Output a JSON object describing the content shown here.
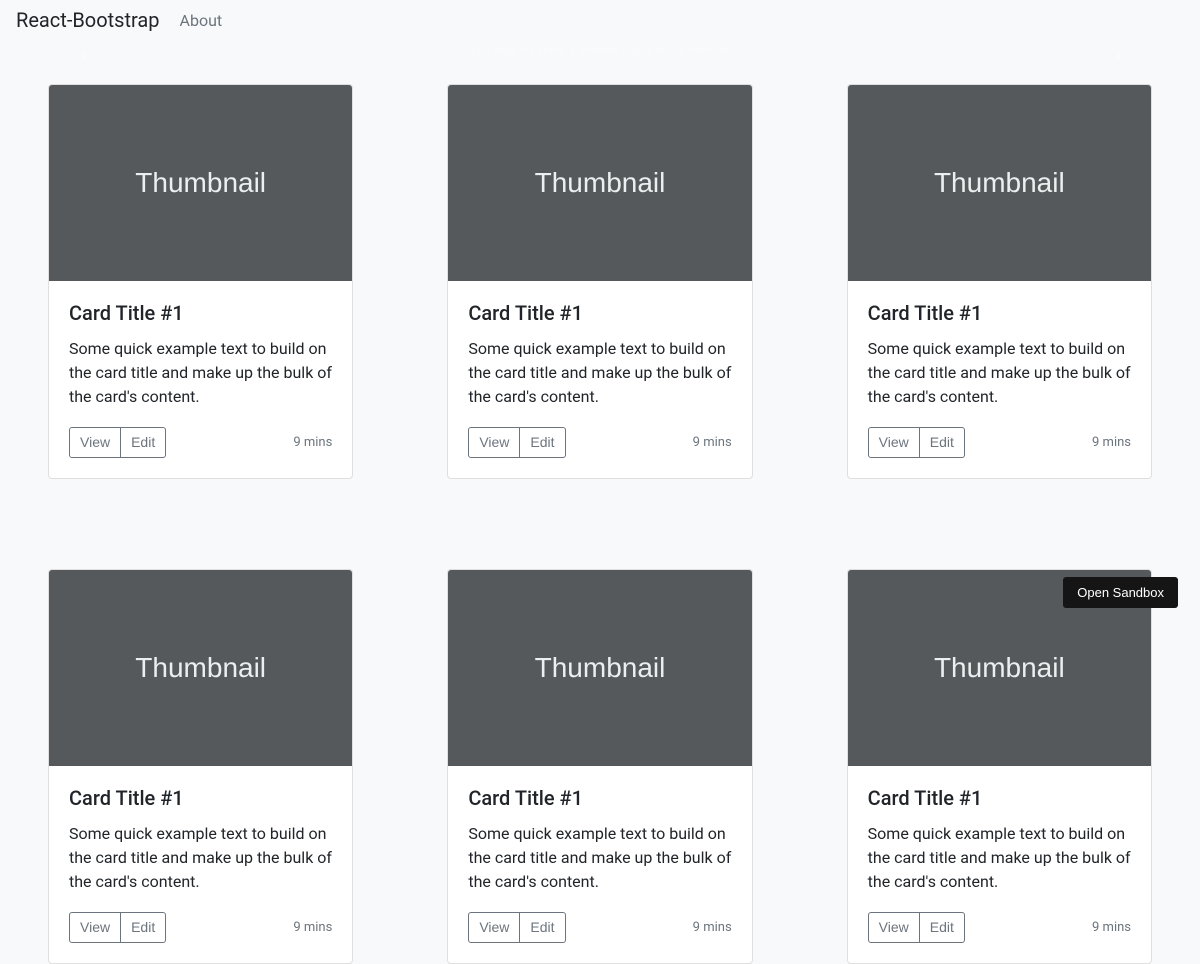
{
  "navbar": {
    "brand": "React-Bootstrap",
    "about": "About"
  },
  "carousel": {
    "caption": "Nulla vitae elit libero, a pharetra augue mollis interdum."
  },
  "thumb_label": "Thumbnail",
  "cards": [
    {
      "title": "Card Title #1",
      "text": "Some quick example text to build on the card title and make up the bulk of the card's content.",
      "view": "View",
      "edit": "Edit",
      "time": "9 mins"
    },
    {
      "title": "Card Title #1",
      "text": "Some quick example text to build on the card title and make up the bulk of the card's content.",
      "view": "View",
      "edit": "Edit",
      "time": "9 mins"
    },
    {
      "title": "Card Title #1",
      "text": "Some quick example text to build on the card title and make up the bulk of the card's content.",
      "view": "View",
      "edit": "Edit",
      "time": "9 mins"
    },
    {
      "title": "Card Title #1",
      "text": "Some quick example text to build on the card title and make up the bulk of the card's content.",
      "view": "View",
      "edit": "Edit",
      "time": "9 mins"
    },
    {
      "title": "Card Title #1",
      "text": "Some quick example text to build on the card title and make up the bulk of the card's content.",
      "view": "View",
      "edit": "Edit",
      "time": "9 mins"
    },
    {
      "title": "Card Title #1",
      "text": "Some quick example text to build on the card title and make up the bulk of the card's content.",
      "view": "View",
      "edit": "Edit",
      "time": "9 mins"
    }
  ],
  "sandbox": {
    "label": "Open Sandbox"
  }
}
